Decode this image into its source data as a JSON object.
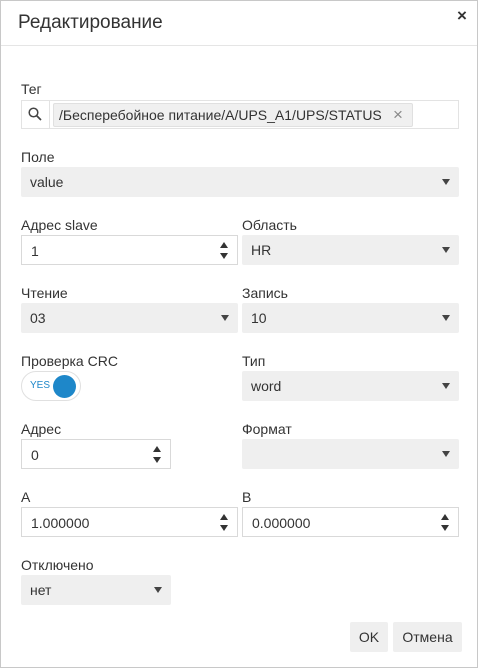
{
  "dialog": {
    "title": "Редактирование",
    "close_glyph": "×"
  },
  "tag": {
    "label": "Тег",
    "value": "/Бесперебойное питание/A/UPS_A1/UPS/STATUS",
    "remove_glyph": "×"
  },
  "field": {
    "label": "Поле",
    "value": "value"
  },
  "slave_address": {
    "label": "Адрес slave",
    "value": "1"
  },
  "area": {
    "label": "Область",
    "value": "HR"
  },
  "read": {
    "label": "Чтение",
    "value": "03"
  },
  "write": {
    "label": "Запись",
    "value": "10"
  },
  "crc_check": {
    "label": "Проверка CRC",
    "toggle_text": "YES",
    "enabled": true
  },
  "type": {
    "label": "Тип",
    "value": "word"
  },
  "address": {
    "label": "Адрес",
    "value": "0"
  },
  "format": {
    "label": "Формат",
    "value": ""
  },
  "coef_a": {
    "label": "A",
    "value": "1.000000"
  },
  "coef_b": {
    "label": "B",
    "value": "0.000000"
  },
  "disabled": {
    "label": "Отключено",
    "value": "нет"
  },
  "buttons": {
    "ok": "OK",
    "cancel": "Отмена"
  },
  "colors": {
    "accent": "#1e87c9",
    "select_bg": "#efefef",
    "border": "#e3e3e3"
  }
}
